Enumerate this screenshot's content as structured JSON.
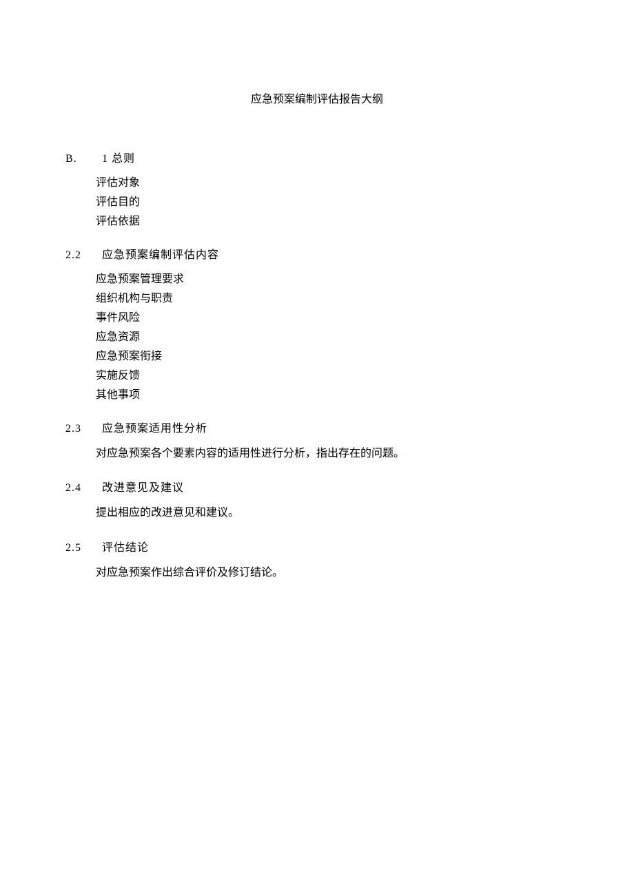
{
  "title": "应急预案编制评估报告大纲",
  "sections": [
    {
      "number": "B.",
      "label": "1 总则",
      "items": [
        "评估对象",
        "评估目的",
        "评估依据"
      ]
    },
    {
      "number": "2.2",
      "label": "应急预案编制评估内容",
      "items": [
        "应急预案管理要求",
        "组织机构与职责",
        "事件风险",
        "应急资源",
        "应急预案衔接",
        "实施反馈",
        "其他事项"
      ]
    },
    {
      "number": "2.3",
      "label": "应急预案适用性分析",
      "body": "对应急预案各个要素内容的适用性进行分析，指出存在的问题。"
    },
    {
      "number": "2.4",
      "label": "改进意见及建议",
      "body": "提出相应的改进意见和建议。"
    },
    {
      "number": "2.5",
      "label": "评估结论",
      "body": "对应急预案作出综合评价及修订结论。"
    }
  ]
}
